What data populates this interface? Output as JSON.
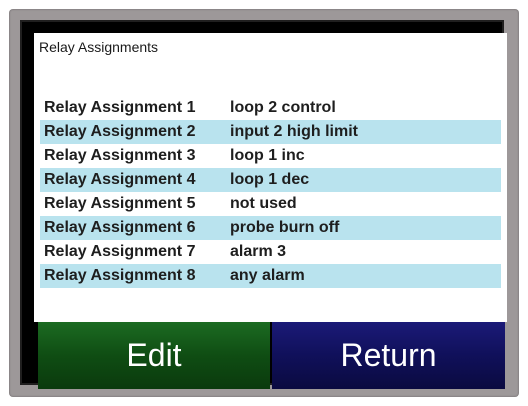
{
  "screen": {
    "title": "Relay Assignments"
  },
  "relays": [
    {
      "label": "Relay Assignment 1",
      "value": "loop 2 control"
    },
    {
      "label": "Relay Assignment 2",
      "value": "input 2 high limit"
    },
    {
      "label": "Relay Assignment 3",
      "value": "loop 1 inc"
    },
    {
      "label": "Relay Assignment 4",
      "value": "loop 1 dec"
    },
    {
      "label": "Relay Assignment 5",
      "value": "not used"
    },
    {
      "label": "Relay Assignment 6",
      "value": "probe burn off"
    },
    {
      "label": "Relay Assignment 7",
      "value": "alarm 3"
    },
    {
      "label": "Relay Assignment 8",
      "value": "any alarm"
    }
  ],
  "buttons": {
    "edit_label": "Edit",
    "return_label": "Return"
  },
  "colors": {
    "alt_row": "#b9e3ee",
    "edit_button": "#0f4d13",
    "return_button": "#10105a",
    "bezel": "#9d9899"
  }
}
